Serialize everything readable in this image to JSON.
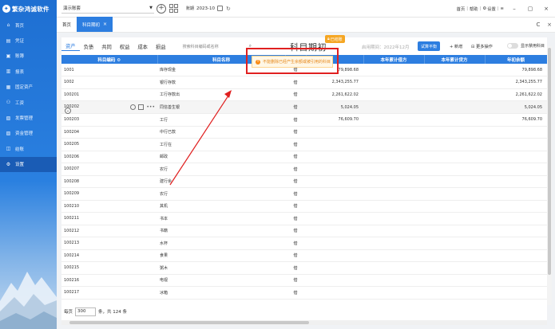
{
  "brand": {
    "name": "繁杂鸿诚软件"
  },
  "sidebar": {
    "items": [
      {
        "label": "首页",
        "icon": "home-icon"
      },
      {
        "label": "凭证",
        "icon": "voucher-icon"
      },
      {
        "label": "账簿",
        "icon": "ledger-icon"
      },
      {
        "label": "报表",
        "icon": "report-icon"
      },
      {
        "label": "固定资产",
        "icon": "asset-icon"
      },
      {
        "label": "工资",
        "icon": "salary-icon"
      },
      {
        "label": "发票管理",
        "icon": "invoice-icon"
      },
      {
        "label": "资金管理",
        "icon": "fund-icon"
      },
      {
        "label": "结账",
        "icon": "checkout-icon"
      },
      {
        "label": "设置",
        "icon": "settings-icon"
      }
    ],
    "active_index": 9
  },
  "topbar": {
    "account": "演示账套",
    "period_label": "账期",
    "period_value": "2023-10",
    "links": [
      "首页",
      "帮助",
      "设置"
    ],
    "win_min": "–",
    "win_max": "▢",
    "win_close": "×"
  },
  "tabs": {
    "home": "首页",
    "active": "科目期初",
    "close": "×",
    "refresh": "C",
    "close_all": "×"
  },
  "toolbar": {
    "categories": [
      "资产",
      "负债",
      "共同",
      "权益",
      "成本",
      "损益"
    ],
    "active_category": 0,
    "search_placeholder": "搜索科目编码或名称",
    "page_title": "科目期初",
    "badge": "已结账",
    "period_text": "启用期间：2022年12月",
    "trial_balance": "试算平衡",
    "add": "+ 新增",
    "more": "更多操作",
    "toggle_label": "显示禁用科目"
  },
  "table": {
    "columns": [
      "科目编码",
      "科目名称",
      "",
      "",
      "本年累计借方",
      "本年累计贷方",
      "年初余额"
    ],
    "rows": [
      {
        "code": "1001",
        "name": "库存现金",
        "dir": "借",
        "c4": "79,898.68",
        "c5": "",
        "c6": "",
        "c7": "79,898.68"
      },
      {
        "code": "1002",
        "name": "银行存款",
        "dir": "借",
        "c4": "2,343,255.77",
        "c5": "",
        "c6": "",
        "c7": "2,343,255.77"
      },
      {
        "code": "100201",
        "name": "工行存款出",
        "dir": "借",
        "c4": "2,261,622.02",
        "c5": "",
        "c6": "",
        "c7": "2,261,622.02"
      },
      {
        "code": "100202",
        "name": "同信善生银",
        "dir": "借",
        "c4": "5,024.05",
        "c5": "",
        "c6": "",
        "c7": "5,024.05"
      },
      {
        "code": "100203",
        "name": "工行",
        "dir": "借",
        "c4": "76,609.70",
        "c5": "",
        "c6": "",
        "c7": "76,609.70"
      },
      {
        "code": "100204",
        "name": "中行已款",
        "dir": "借",
        "c4": "",
        "c5": "",
        "c6": "",
        "c7": ""
      },
      {
        "code": "100205",
        "name": "工行在",
        "dir": "借",
        "c4": "",
        "c5": "",
        "c6": "",
        "c7": ""
      },
      {
        "code": "100206",
        "name": "邮政",
        "dir": "借",
        "c4": "",
        "c5": "",
        "c6": "",
        "c7": ""
      },
      {
        "code": "100207",
        "name": "农行",
        "dir": "借",
        "c4": "",
        "c5": "",
        "c6": "",
        "c7": ""
      },
      {
        "code": "100208",
        "name": "建行余",
        "dir": "借",
        "c4": "",
        "c5": "",
        "c6": "",
        "c7": ""
      },
      {
        "code": "100209",
        "name": "农行",
        "dir": "借",
        "c4": "",
        "c5": "",
        "c6": "",
        "c7": ""
      },
      {
        "code": "100210",
        "name": "其机",
        "dir": "借",
        "c4": "",
        "c5": "",
        "c6": "",
        "c7": ""
      },
      {
        "code": "100211",
        "name": "书本",
        "dir": "借",
        "c4": "",
        "c5": "",
        "c6": "",
        "c7": ""
      },
      {
        "code": "100212",
        "name": "书籍",
        "dir": "借",
        "c4": "",
        "c5": "",
        "c6": "",
        "c7": ""
      },
      {
        "code": "100213",
        "name": "水杯",
        "dir": "借",
        "c4": "",
        "c5": "",
        "c6": "",
        "c7": ""
      },
      {
        "code": "100214",
        "name": "食果",
        "dir": "借",
        "c4": "",
        "c5": "",
        "c6": "",
        "c7": ""
      },
      {
        "code": "100215",
        "name": "粥木",
        "dir": "借",
        "c4": "",
        "c5": "",
        "c6": "",
        "c7": ""
      },
      {
        "code": "100216",
        "name": "电视",
        "dir": "借",
        "c4": "",
        "c5": "",
        "c6": "",
        "c7": ""
      },
      {
        "code": "100217",
        "name": "冰箱",
        "dir": "借",
        "c4": "",
        "c5": "",
        "c6": "",
        "c7": ""
      }
    ],
    "highlight_row": 3
  },
  "footer": {
    "per_page_label": "每页",
    "per_page": "300",
    "total": "条，共 124 条"
  },
  "tooltip": {
    "text": "不能删除已经产生余额或被引用的科目"
  },
  "colors": {
    "primary": "#2d7ee0",
    "warning": "#fa8c16",
    "annotation": "#e02020"
  }
}
